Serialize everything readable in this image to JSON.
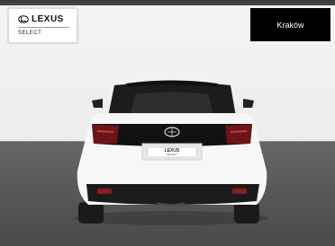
{
  "brand": {
    "wordmark": "LEXUS",
    "sub_label": "SELECT"
  },
  "location": {
    "label": "Kraków"
  },
  "plate": {
    "badge": "SELECT"
  },
  "icons": {
    "brand_logo": "lexus-emblem-icon"
  },
  "colors": {
    "car_body": "#f7f7f7",
    "badge_bg": "#000000",
    "floor": "#555555"
  }
}
